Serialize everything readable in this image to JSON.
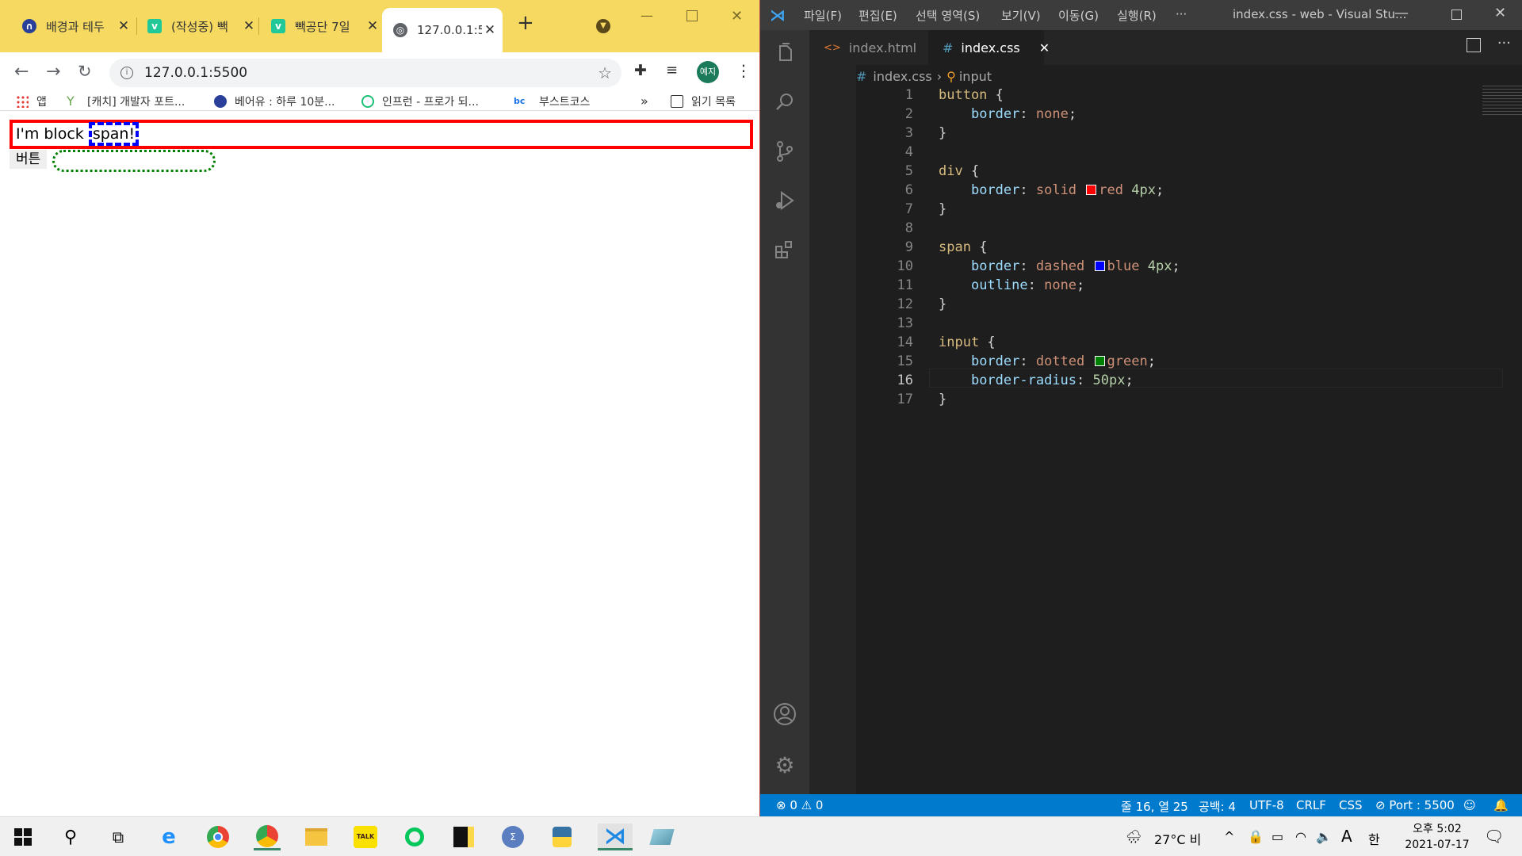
{
  "browser": {
    "tabs": [
      {
        "title": "배경과 테두",
        "favicon": "bear-icon",
        "color": "#2a3f9a",
        "glyph": "∩"
      },
      {
        "title": "(작성중) 빽",
        "favicon": "velog-icon",
        "color": "#20c997",
        "glyph": "v"
      },
      {
        "title": "빽공단 7일",
        "favicon": "velog-icon",
        "color": "#20c997",
        "glyph": "v"
      },
      {
        "title": "127.0.0.1:5",
        "favicon": "globe-icon",
        "color": "#5f6368",
        "glyph": "◎"
      }
    ],
    "new_tab": "+",
    "url": "127.0.0.1:5500",
    "profile": "예지",
    "bookmarks": [
      {
        "label": "앱",
        "icon": "apps-grid-icon"
      },
      {
        "label": "[캐치] 개발자 포트...",
        "icon": "sprout-icon"
      },
      {
        "label": "베어유 : 하루 10분...",
        "icon": "bear-icon"
      },
      {
        "label": "인프런 - 프로가 되...",
        "icon": "inflearn-icon"
      },
      {
        "label": "부스트코스",
        "icon": "bc-icon"
      }
    ],
    "bookmark_overflow": "»",
    "reading_list": "읽기 목록",
    "page": {
      "div_text": "I'm block ",
      "span_text": "span!",
      "button_text": "버튼"
    }
  },
  "vscode": {
    "menu": [
      "파일(F)",
      "편집(E)",
      "선택 영역(S)",
      "보기(V)",
      "이동(G)",
      "실행(R)",
      "···"
    ],
    "window_title": "index.css - web - Visual Stu...",
    "editor_tabs": [
      {
        "label": "index.html",
        "icon": "html-icon",
        "active": false
      },
      {
        "label": "index.css",
        "icon": "css-icon",
        "active": true
      }
    ],
    "breadcrumb": {
      "file": "index.css",
      "symbol": "input"
    },
    "lines": [
      {
        "n": "1",
        "text": "button {"
      },
      {
        "n": "2",
        "text": "    border: none;"
      },
      {
        "n": "3",
        "text": "}"
      },
      {
        "n": "4",
        "text": ""
      },
      {
        "n": "5",
        "text": "div {"
      },
      {
        "n": "6",
        "text": "    border: solid red 4px;"
      },
      {
        "n": "7",
        "text": "}"
      },
      {
        "n": "8",
        "text": ""
      },
      {
        "n": "9",
        "text": "span {"
      },
      {
        "n": "10",
        "text": "    border: dashed blue 4px;"
      },
      {
        "n": "11",
        "text": "    outline: none;"
      },
      {
        "n": "12",
        "text": "}"
      },
      {
        "n": "13",
        "text": ""
      },
      {
        "n": "14",
        "text": "input {"
      },
      {
        "n": "15",
        "text": "    border: dotted green;"
      },
      {
        "n": "16",
        "text": "    border-radius: 50px;"
      },
      {
        "n": "17",
        "text": "}"
      }
    ],
    "status": {
      "problems": "⊗ 0 ⚠ 0",
      "position": "줄 16, 열 25",
      "spaces": "공백: 4",
      "encoding": "UTF-8",
      "eol": "CRLF",
      "language": "CSS",
      "port": "⊘ Port : 5500"
    }
  },
  "taskbar": {
    "weather": "27°C  비",
    "ime": "A",
    "lang": "한",
    "time": "오후 5:02",
    "date": "2021-07-17"
  }
}
